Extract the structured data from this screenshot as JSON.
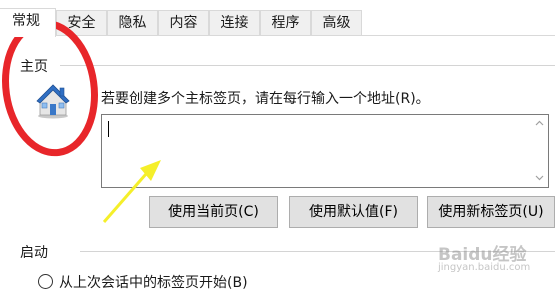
{
  "tabs": [
    {
      "label": "常规",
      "active": true
    },
    {
      "label": "安全",
      "active": false
    },
    {
      "label": "隐私",
      "active": false
    },
    {
      "label": "内容",
      "active": false
    },
    {
      "label": "连接",
      "active": false
    },
    {
      "label": "程序",
      "active": false
    },
    {
      "label": "高级",
      "active": false
    }
  ],
  "home": {
    "title": "主页",
    "icon": "house-icon",
    "instruction": "若要创建多个主标签页，请在每行输入一个地址(R)。",
    "address_value": "",
    "buttons": {
      "use_current": "使用当前页(C)",
      "use_default": "使用默认值(F)",
      "use_new_tab": "使用新标签页(U)"
    }
  },
  "startup": {
    "title": "启动",
    "option_1": "从上次会话中的标签页开始(B)"
  },
  "annotations": {
    "highlight_color": "#e8262a",
    "arrow_color": "#f5ef2a"
  },
  "watermark": {
    "brand": "Baidu经验",
    "url": "jingyan.baidu.com"
  }
}
